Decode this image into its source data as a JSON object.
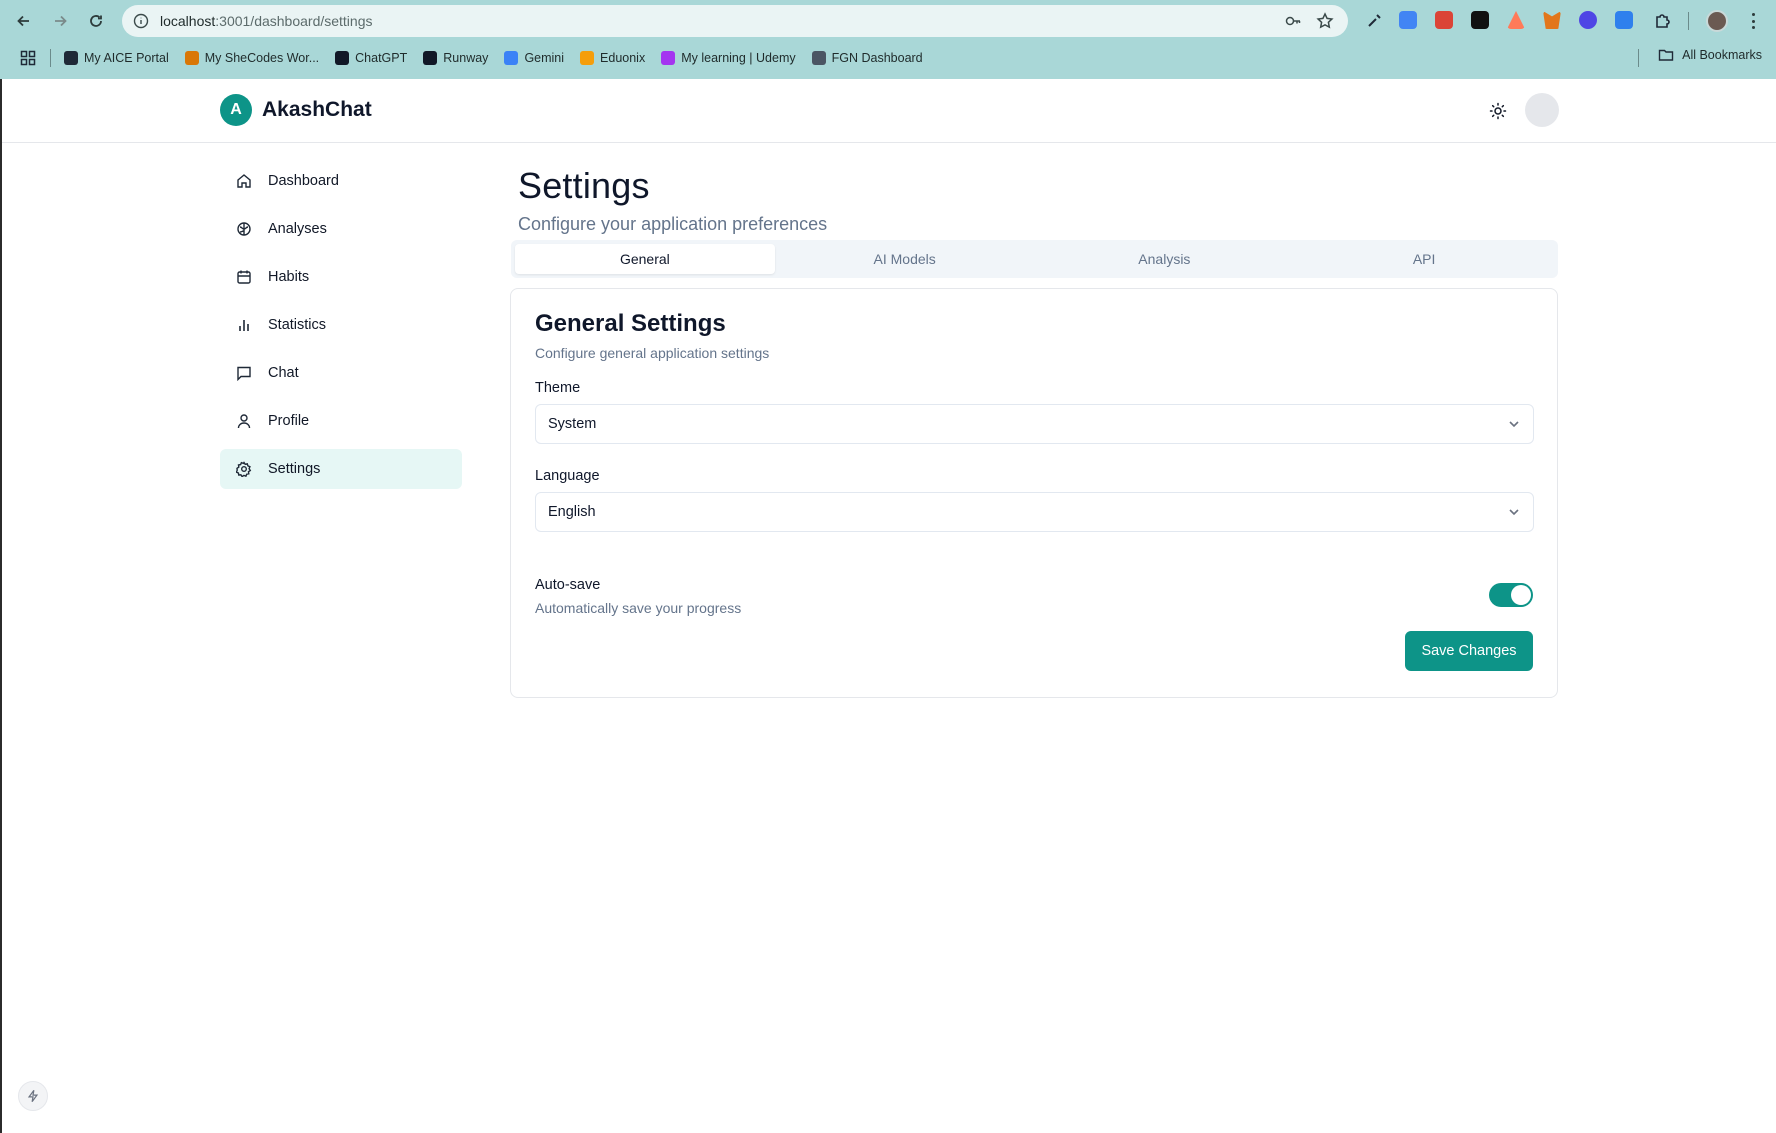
{
  "browser": {
    "url_host": "localhost",
    "url_rest": ":3001/dashboard/settings",
    "bookmarks": [
      {
        "label": "My AICE Portal",
        "icon": "alx-icon",
        "color": "#1f2937"
      },
      {
        "label": "My SheCodes Wor...",
        "icon": "shecodes-icon",
        "color": "#d97706"
      },
      {
        "label": "ChatGPT",
        "icon": "chatgpt-icon",
        "color": "#111827"
      },
      {
        "label": "Runway",
        "icon": "runway-icon",
        "color": "#111827"
      },
      {
        "label": "Gemini",
        "icon": "gemini-icon",
        "color": "#3b82f6"
      },
      {
        "label": "Eduonix",
        "icon": "eduonix-icon",
        "color": "#f59e0b"
      },
      {
        "label": "My learning | Udemy",
        "icon": "udemy-icon",
        "color": "#a435f0"
      },
      {
        "label": "FGN Dashboard",
        "icon": "fgn-icon",
        "color": "#4b5563"
      }
    ],
    "all_bookmarks": "All Bookmarks"
  },
  "app": {
    "brand_initial": "A",
    "brand_name": "AkashChat",
    "accent": "#0d9488"
  },
  "sidebar": {
    "items": [
      {
        "label": "Dashboard",
        "icon": "home-icon",
        "active": false
      },
      {
        "label": "Analyses",
        "icon": "brain-icon",
        "active": false
      },
      {
        "label": "Habits",
        "icon": "calendar-icon",
        "active": false
      },
      {
        "label": "Statistics",
        "icon": "bar-chart-icon",
        "active": false
      },
      {
        "label": "Chat",
        "icon": "message-square-icon",
        "active": false
      },
      {
        "label": "Profile",
        "icon": "user-icon",
        "active": false
      },
      {
        "label": "Settings",
        "icon": "settings-icon",
        "active": true
      }
    ]
  },
  "main": {
    "title": "Settings",
    "subtitle": "Configure your application preferences",
    "tabs": [
      {
        "label": "General",
        "active": true
      },
      {
        "label": "AI Models",
        "active": false
      },
      {
        "label": "Analysis",
        "active": false
      },
      {
        "label": "API",
        "active": false
      }
    ],
    "card": {
      "title": "General Settings",
      "subtitle": "Configure general application settings",
      "theme_label": "Theme",
      "theme_value": "System",
      "language_label": "Language",
      "language_value": "English",
      "autosave_label": "Auto-save",
      "autosave_desc": "Automatically save your progress",
      "autosave_on": true,
      "save_label": "Save Changes"
    }
  }
}
